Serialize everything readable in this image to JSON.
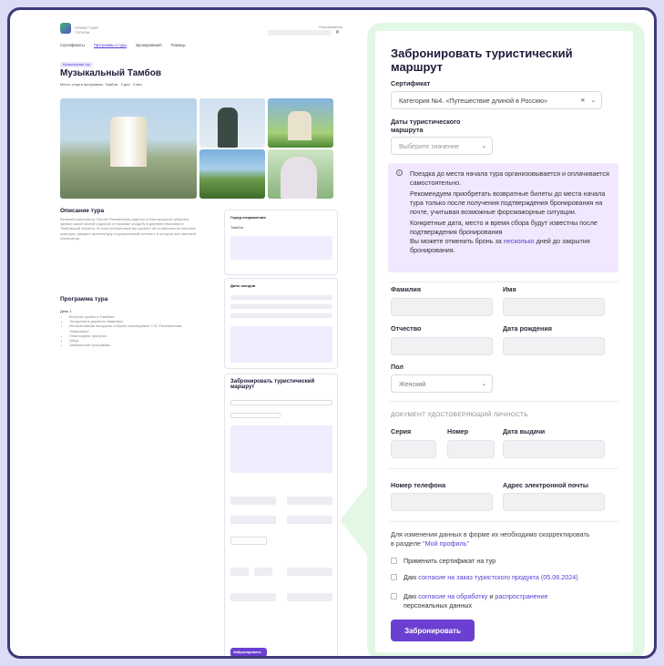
{
  "left": {
    "logo_text": "ПРИВЕТ МИР ТУРИЗМ",
    "account_label": "Пользователь",
    "nav": [
      "Сертификаты",
      "Программы и туры",
      "Бронирования",
      "Помощь"
    ],
    "badge": "Музыкальный тур",
    "title": "Музыкальный Тамбов",
    "meta": "Место старта программы: Тамбов · 3 дня · 5 вел",
    "description_title": "Описание тура",
    "description_text": "Великий композитор Сергей Рахманинов родился в Новгородской губернии, однако самой малой родиной он называл усадьбу в деревне Ивановка в Тамбовской области. В этом путешествии вы узнаете об особенностях местной культуры, увидите архитектуру и музыкальный контекст, в котором жил великий композитор.",
    "program_title": "Программа тура",
    "program_day": "День 1",
    "program_items": [
      "Встреча группы в Тамбове",
      "Экскурсия в деревню Ивановка",
      "Интерактивная экскурсия в Музее-заповеднике С.В. Рахманинова «Ивановка»",
      "Пешеходная прогулка",
      "Обед",
      "Завершение программы"
    ],
    "card1_title": "Город отправления",
    "card1_value": "Тамбов",
    "card2_title": "Даты заездов",
    "mini_form_title": "Забронировать туристический маршрут",
    "mini_submit": "Забронировать"
  },
  "form": {
    "title": "Забронировать туристический маршрут",
    "certificate_label": "Сертификат",
    "certificate_value": "Категория №4. «Путешествие длиной в Россию»",
    "dates_label": "Даты туристического маршрута",
    "dates_placeholder": "Выберите значение",
    "note": {
      "p1": "Поездка до места начала тура организовывается и оплачивается самостоятельно.",
      "p2": "Рекомендуем приобретать возвратные билеты до места начала тура только после получения подтверждения бронирования на почте, учитывая возможные форсмажорные ситуации.",
      "p3": "Конкретные дата, место и время сбора будут известны после подтверждения бронирования",
      "p4_pre": "Вы можете отменить бронь за",
      "p4_link": "несколько",
      "p4_post": "дней до закрытия бронирования."
    },
    "surname_label": "Фамилия",
    "name_label": "Имя",
    "patronymic_label": "Отчество",
    "birthdate_label": "Дата рождения",
    "gender_label": "Пол",
    "gender_value": "Женский",
    "doc_section": "ДОКУМЕНТ УДОСТОВЕРЯЮЩИЙ ЛИЧНОСТЬ",
    "series_label": "Серия",
    "number_label": "Номер",
    "issue_date_label": "Дата выдачи",
    "phone_label": "Номер телефона",
    "email_label": "Адрес электронной почты",
    "info_pre": "Для изменения данных в форме их необходимо скорректировать в разделе",
    "info_link": "\"Мой профиль\"",
    "cb1": "Применить сертификат на тур",
    "cb2_pre": "Даю",
    "cb2_link": "согласие на заказ туристского продукта (05.06.2024)",
    "cb3_pre": "Даю",
    "cb3_link1": "согласие на обработку",
    "cb3_mid": "и",
    "cb3_link2": "распространение",
    "cb3_post": "персональных данных",
    "submit": "Забронировать"
  },
  "colors": {
    "accent": "#6a3fd1",
    "note_bg": "#f1e8ff",
    "frame_bg": "#e3f7e5"
  }
}
